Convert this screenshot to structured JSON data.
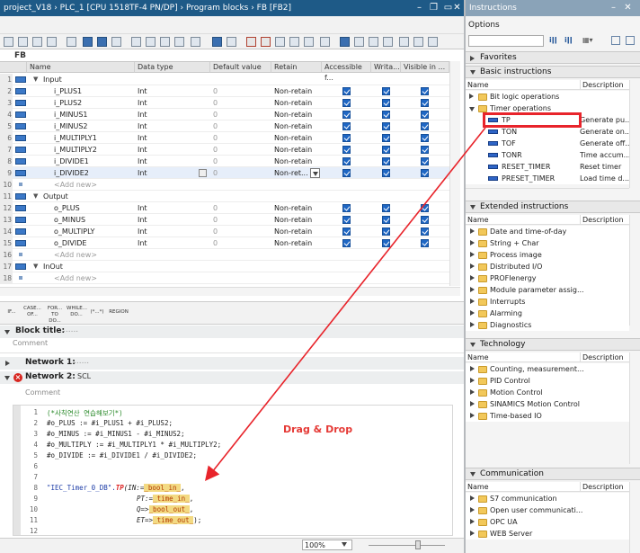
{
  "editor": {
    "breadcrumb": "project_V18  ›  PLC_1 [CPU 1518TF-4 PN/DP]  ›  Program blocks  ›  FB [FB2]",
    "block_label": "FB",
    "columns": [
      "Name",
      "Data type",
      "Default value",
      "Retain",
      "Accessible f...",
      "Writa...",
      "Visible in ..."
    ],
    "rows": [
      {
        "n": "1",
        "kind": "section",
        "name": "Input"
      },
      {
        "n": "2",
        "kind": "var",
        "name": "i_PLUS1",
        "type": "Int",
        "def": "0",
        "retain": "Non-retain"
      },
      {
        "n": "3",
        "kind": "var",
        "name": "i_PLUS2",
        "type": "Int",
        "def": "0",
        "retain": "Non-retain"
      },
      {
        "n": "4",
        "kind": "var",
        "name": "i_MINUS1",
        "type": "Int",
        "def": "0",
        "retain": "Non-retain"
      },
      {
        "n": "5",
        "kind": "var",
        "name": "i_MINUS2",
        "type": "Int",
        "def": "0",
        "retain": "Non-retain"
      },
      {
        "n": "6",
        "kind": "var",
        "name": "i_MULTIPLY1",
        "type": "Int",
        "def": "0",
        "retain": "Non-retain"
      },
      {
        "n": "7",
        "kind": "var",
        "name": "i_MULTIPLY2",
        "type": "Int",
        "def": "0",
        "retain": "Non-retain"
      },
      {
        "n": "8",
        "kind": "var",
        "name": "i_DIVIDE1",
        "type": "Int",
        "def": "0",
        "retain": "Non-retain"
      },
      {
        "n": "9",
        "kind": "var",
        "name": "i_DIVIDE2",
        "type": "Int",
        "def": "0",
        "retain": "Non-ret...",
        "selected": true
      },
      {
        "n": "10",
        "kind": "add",
        "name": "<Add new>"
      },
      {
        "n": "11",
        "kind": "section",
        "name": "Output"
      },
      {
        "n": "12",
        "kind": "var",
        "name": "o_PLUS",
        "type": "Int",
        "def": "0",
        "retain": "Non-retain"
      },
      {
        "n": "13",
        "kind": "var",
        "name": "o_MINUS",
        "type": "Int",
        "def": "0",
        "retain": "Non-retain"
      },
      {
        "n": "14",
        "kind": "var",
        "name": "o_MULTIPLY",
        "type": "Int",
        "def": "0",
        "retain": "Non-retain"
      },
      {
        "n": "15",
        "kind": "var",
        "name": "o_DIVIDE",
        "type": "Int",
        "def": "0",
        "retain": "Non-retain"
      },
      {
        "n": "16",
        "kind": "add",
        "name": "<Add new>"
      },
      {
        "n": "17",
        "kind": "section",
        "name": "InOut"
      },
      {
        "n": "18",
        "kind": "add",
        "name": "<Add new>"
      }
    ],
    "scl_buttons": [
      "IF...",
      "CASE...\nOF...",
      "FOR...\nTO DO...",
      "WHILE...\nDO...",
      "(*...*)",
      "REGION"
    ],
    "block_title": "Block title:",
    "block_comment": "Comment",
    "network1": "Network 1:",
    "network1_dots": "......",
    "network2": "Network 2:",
    "network2_lang": "SCL",
    "network2_comment": "Comment",
    "code_lines": [
      "1",
      "2",
      "3",
      "4",
      "5",
      "6",
      "7",
      "8",
      "9",
      "10",
      "11",
      "12"
    ],
    "code_text": {
      "l1": "(*사칙연산 연습해보기*)",
      "l2": "#o_PLUS := #i_PLUS1 + #i_PLUS2;",
      "l3": "#o_MINUS := #i_MINUS1 - #i_MINUS2;",
      "l4": "#o_MULTIPLY := #i_MULTIPLY1 * #i_MULTIPLY2;",
      "l5": "#o_DIVIDE := #i_DIVIDE1 / #i_DIVIDE2;",
      "l8a": "\"IEC_Timer_0_DB\".",
      "l8b": "TP",
      "l8c": "(IN:=",
      "l8d": "_bool_in_",
      "l8e": ",",
      "l9a": "PT:=",
      "l9b": "_time_in_",
      "l9c": ",",
      "l10a": "Q=>",
      "l10b": "_bool_out_",
      "l10c": ",",
      "l11a": "ET=>",
      "l11b": "_time_out_",
      "l11c": ");"
    },
    "annotation": "Drag & Drop",
    "zoom": "100%"
  },
  "instructions": {
    "title": "Instructions",
    "options_label": "Options",
    "favorites": "Favorites",
    "basic": {
      "title": "Basic instructions",
      "col_name": "Name",
      "col_desc": "Description",
      "items": [
        {
          "label": "Bit logic operations",
          "desc": "",
          "level": 1,
          "icon": "folder"
        },
        {
          "label": "Timer operations",
          "desc": "",
          "level": 1,
          "icon": "timer-folder"
        },
        {
          "label": "TP",
          "desc": "Generate pu...",
          "level": 2,
          "icon": "timer"
        },
        {
          "label": "TON",
          "desc": "Generate on...",
          "level": 2,
          "icon": "timer"
        },
        {
          "label": "TOF",
          "desc": "Generate off...",
          "level": 2,
          "icon": "timer"
        },
        {
          "label": "TONR",
          "desc": "Time accum...",
          "level": 2,
          "icon": "timer"
        },
        {
          "label": "RESET_TIMER",
          "desc": "Reset timer",
          "level": 2,
          "icon": "timer"
        },
        {
          "label": "PRESET_TIMER",
          "desc": "Load time d...",
          "level": 2,
          "icon": "timer"
        }
      ]
    },
    "extended": {
      "title": "Extended instructions",
      "col_name": "Name",
      "col_desc": "Description",
      "items": [
        "Date and time-of-day",
        "String + Char",
        "Process image",
        "Distributed I/O",
        "PROFIenergy",
        "Module parameter assig...",
        "Interrupts",
        "Alarming",
        "Diagnostics"
      ]
    },
    "technology": {
      "title": "Technology",
      "col_name": "Name",
      "col_desc": "Description",
      "items": [
        "Counting, measurement...",
        "PID Control",
        "Motion Control",
        "SINAMICS Motion Control",
        "Time-based IO"
      ]
    },
    "communication": {
      "title": "Communication",
      "col_name": "Name",
      "col_desc": "Description",
      "items": [
        "S7 communication",
        "Open user communicati...",
        "OPC UA",
        "WEB Server"
      ]
    }
  },
  "colors": {
    "accent_blue": "#1e5a87",
    "checkbox_blue": "#1f67c4",
    "highlight_red": "#e8242b",
    "param_highlight": "#f3da83"
  }
}
